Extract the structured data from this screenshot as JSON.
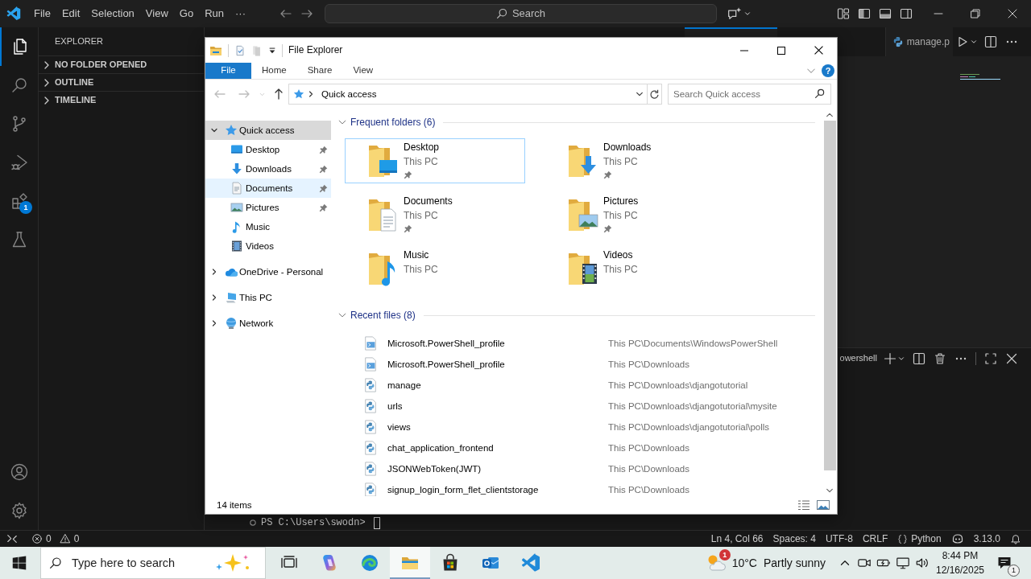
{
  "vscode": {
    "menu": [
      "File",
      "Edit",
      "Selection",
      "View",
      "Go",
      "Run",
      "···"
    ],
    "command_center": {
      "label": "Search"
    },
    "activity_bar": [
      {
        "kind": "explorer",
        "selected": true
      },
      {
        "kind": "search",
        "selected": false
      },
      {
        "kind": "scm",
        "selected": false
      },
      {
        "kind": "debug",
        "selected": false
      },
      {
        "kind": "extensions",
        "selected": false,
        "badge": "1"
      },
      {
        "kind": "testing",
        "selected": false
      }
    ],
    "activity_bar_bottom": [
      {
        "kind": "accounts"
      },
      {
        "kind": "manage"
      }
    ],
    "sidebar": {
      "title": "EXPLORER",
      "sections": [
        {
          "label": "NO FOLDER OPENED",
          "expanded": false
        },
        {
          "label": "OUTLINE",
          "expanded": false
        },
        {
          "label": "TIMELINE",
          "expanded": false
        }
      ]
    },
    "editor_tab": {
      "label": "manage.p"
    },
    "panel": {
      "terminal_label": "owershell",
      "prompt": "PS C:\\Users\\swodn>"
    },
    "status_bar": {
      "problems": [
        {
          "kind": "error",
          "count": "0"
        },
        {
          "kind": "warning",
          "count": "0"
        }
      ],
      "items": [
        {
          "kind": "text",
          "label": "Ln 4, Col 66"
        },
        {
          "kind": "text",
          "label": "Spaces: 4"
        },
        {
          "kind": "text",
          "label": "UTF-8"
        },
        {
          "kind": "text",
          "label": "CRLF"
        },
        {
          "kind": "language",
          "label": "Python"
        },
        {
          "kind": "copilot"
        },
        {
          "kind": "text",
          "label": "3.13.0"
        },
        {
          "kind": "bell"
        }
      ]
    }
  },
  "explorer_window": {
    "title": "File Explorer",
    "ribbon": [
      {
        "label": "File",
        "kind": "backstage",
        "selected": false
      },
      {
        "label": "Home",
        "kind": "tab",
        "selected": false
      },
      {
        "label": "Share",
        "kind": "tab",
        "selected": false
      },
      {
        "label": "View",
        "kind": "tab",
        "selected": false
      }
    ],
    "help": "?",
    "nav_buttons": [
      {
        "kind": "back",
        "disabled": true
      },
      {
        "kind": "forward",
        "disabled": true
      },
      {
        "kind": "recent",
        "disabled": true
      },
      {
        "kind": "up",
        "disabled": false
      }
    ],
    "address": {
      "location": "Quick access"
    },
    "search": {
      "placeholder": "Search Quick access"
    },
    "nav": [
      {
        "label": "Quick access",
        "kind": "quickaccess",
        "expanded": true,
        "selected": true,
        "children": [
          {
            "label": "Desktop",
            "kind": "desktop",
            "pinned": true,
            "hovered": false,
            "selected": false
          },
          {
            "label": "Downloads",
            "kind": "downloads",
            "pinned": true,
            "hovered": false,
            "selected": false
          },
          {
            "label": "Documents",
            "kind": "documents",
            "pinned": true,
            "hovered": true,
            "selected": false
          },
          {
            "label": "Pictures",
            "kind": "pictures",
            "pinned": true,
            "hovered": false,
            "selected": false
          },
          {
            "label": "Music",
            "kind": "music",
            "pinned": false,
            "hovered": false,
            "selected": false
          },
          {
            "label": "Videos",
            "kind": "videos",
            "pinned": false,
            "hovered": false,
            "selected": false
          }
        ]
      },
      {
        "label": "OneDrive - Personal",
        "kind": "onedrive",
        "expanded": false,
        "selected": false
      },
      {
        "label": "This PC",
        "kind": "pc",
        "expanded": false,
        "selected": false
      },
      {
        "label": "Network",
        "kind": "network",
        "expanded": false,
        "selected": false
      }
    ],
    "groups": [
      {
        "title": "Frequent folders (6)",
        "kind": "folders",
        "expanded": true,
        "items": [
          {
            "name": "Desktop",
            "location": "This PC",
            "kind": "desktop",
            "pinned": true,
            "selected": true
          },
          {
            "name": "Downloads",
            "location": "This PC",
            "kind": "downloads",
            "pinned": true,
            "selected": false
          },
          {
            "name": "Documents",
            "location": "This PC",
            "kind": "documents",
            "pinned": true,
            "selected": false
          },
          {
            "name": "Pictures",
            "location": "This PC",
            "kind": "pictures",
            "pinned": true,
            "selected": false
          },
          {
            "name": "Music",
            "location": "This PC",
            "kind": "music",
            "pinned": false,
            "selected": false
          },
          {
            "name": "Videos",
            "location": "This PC",
            "kind": "videos",
            "pinned": false,
            "selected": false
          }
        ]
      },
      {
        "title": "Recent files (8)",
        "kind": "files",
        "expanded": true,
        "items": [
          {
            "name": "Microsoft.PowerShell_profile",
            "path": "This PC\\Documents\\WindowsPowerShell",
            "kind": "powershell",
            "selected": false
          },
          {
            "name": "Microsoft.PowerShell_profile",
            "path": "This PC\\Downloads",
            "kind": "powershell",
            "selected": false
          },
          {
            "name": "manage",
            "path": "This PC\\Downloads\\djangotutorial",
            "kind": "python",
            "selected": false
          },
          {
            "name": "urls",
            "path": "This PC\\Downloads\\djangotutorial\\mysite",
            "kind": "python",
            "selected": false
          },
          {
            "name": "views",
            "path": "This PC\\Downloads\\djangotutorial\\polls",
            "kind": "python",
            "selected": false
          },
          {
            "name": "chat_application_frontend",
            "path": "This PC\\Downloads",
            "kind": "python",
            "selected": false
          },
          {
            "name": "JSONWebToken(JWT)",
            "path": "This PC\\Downloads",
            "kind": "python",
            "selected": false
          },
          {
            "name": "signup_login_form_flet_clientstorage",
            "path": "This PC\\Downloads",
            "kind": "python",
            "selected": false
          }
        ]
      }
    ],
    "status": "14 items"
  },
  "taskbar": {
    "search": {
      "placeholder": "Type here to search"
    },
    "apps": [
      {
        "kind": "taskview",
        "active": false
      },
      {
        "kind": "copilot",
        "active": false
      },
      {
        "kind": "browser",
        "active": false
      },
      {
        "kind": "files",
        "active": true
      },
      {
        "kind": "store",
        "active": false
      },
      {
        "kind": "mail",
        "active": false
      },
      {
        "kind": "editor",
        "active": false
      }
    ],
    "weather": {
      "temperature": "10°C",
      "condition": "Partly sunny",
      "badge": "1"
    },
    "tray": [
      {
        "kind": "chevron"
      },
      {
        "kind": "meet"
      },
      {
        "kind": "power"
      },
      {
        "kind": "network"
      },
      {
        "kind": "volume"
      }
    ],
    "clock": {
      "time": "8:44 PM",
      "date": "12/16/2025"
    },
    "notifications": {
      "badge": "1"
    }
  }
}
